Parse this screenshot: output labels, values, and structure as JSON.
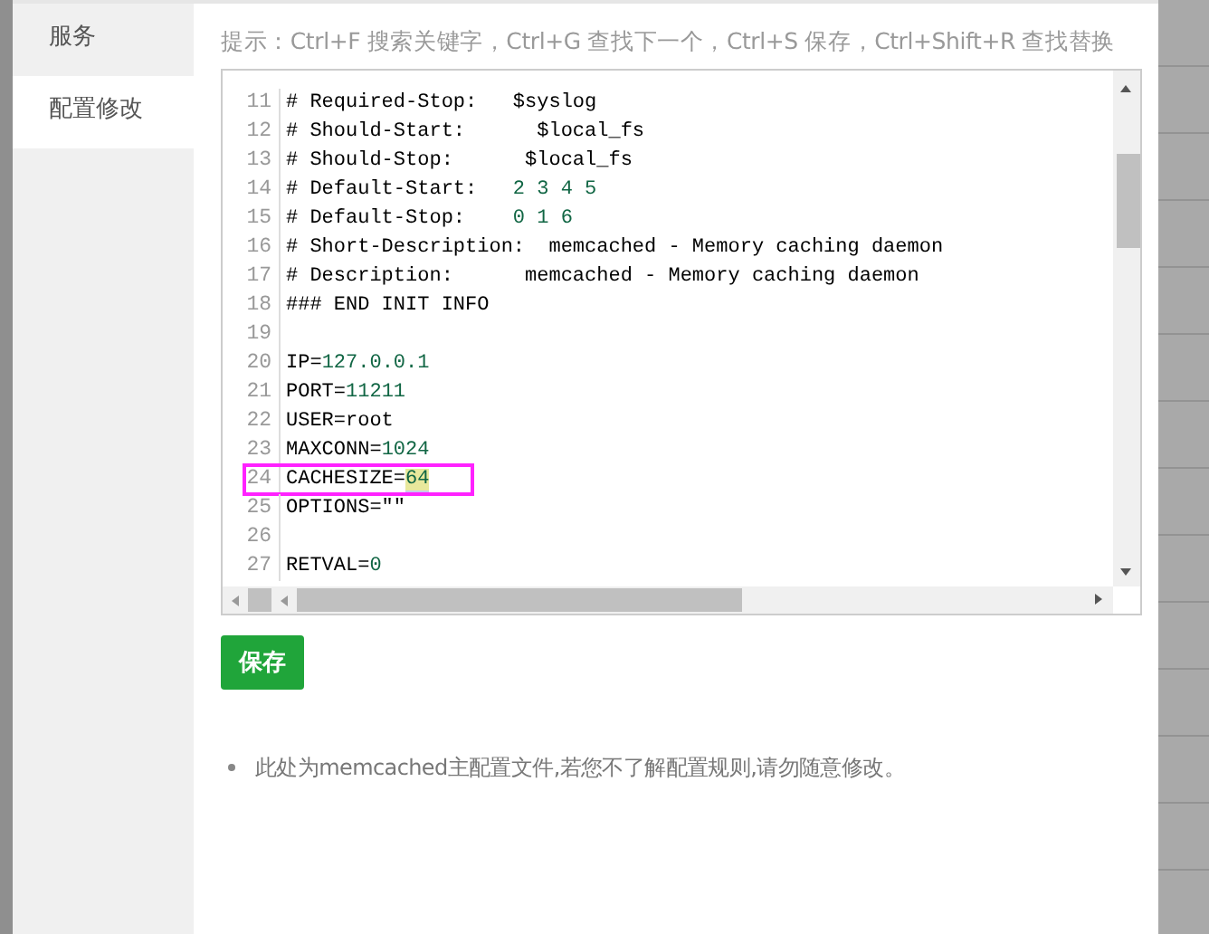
{
  "tabs": [
    {
      "label": "服务",
      "selected": false
    },
    {
      "label": "配置修改",
      "selected": true
    }
  ],
  "hint": "提示：Ctrl+F 搜索关键字，Ctrl+G 查找下一个，Ctrl+S 保存，Ctrl+Shift+R 查找替换",
  "editor": {
    "lines": [
      {
        "number": "11",
        "annotated": false,
        "tokens": [
          {
            "kind": "text",
            "text": "# Required-Stop:   $syslog"
          }
        ]
      },
      {
        "number": "12",
        "annotated": false,
        "tokens": [
          {
            "kind": "text",
            "text": "# Should-Start:      $local_fs"
          }
        ]
      },
      {
        "number": "13",
        "annotated": false,
        "tokens": [
          {
            "kind": "text",
            "text": "# Should-Stop:      $local_fs"
          }
        ]
      },
      {
        "number": "14",
        "annotated": false,
        "tokens": [
          {
            "kind": "text",
            "text": "# Default-Start:   "
          },
          {
            "kind": "number",
            "text": "2 3 4 5"
          }
        ]
      },
      {
        "number": "15",
        "annotated": false,
        "tokens": [
          {
            "kind": "text",
            "text": "# Default-Stop:    "
          },
          {
            "kind": "number",
            "text": "0 1 6"
          }
        ]
      },
      {
        "number": "16",
        "annotated": false,
        "tokens": [
          {
            "kind": "text",
            "text": "# Short-Description:  memcached - Memory caching daemon"
          }
        ]
      },
      {
        "number": "17",
        "annotated": false,
        "tokens": [
          {
            "kind": "text",
            "text": "# Description:      memcached - Memory caching daemon"
          }
        ]
      },
      {
        "number": "18",
        "annotated": false,
        "tokens": [
          {
            "kind": "text",
            "text": "### END INIT INFO"
          }
        ]
      },
      {
        "number": "19",
        "annotated": false
      },
      {
        "number": "20",
        "annotated": false,
        "tokens": [
          {
            "kind": "text",
            "text": "IP="
          },
          {
            "kind": "number",
            "text": "127.0.0.1"
          }
        ]
      },
      {
        "number": "21",
        "annotated": false,
        "tokens": [
          {
            "kind": "text",
            "text": "PORT="
          },
          {
            "kind": "number",
            "text": "11211"
          }
        ]
      },
      {
        "number": "22",
        "annotated": false,
        "tokens": [
          {
            "kind": "text",
            "text": "USER=root"
          }
        ]
      },
      {
        "number": "23",
        "annotated": false,
        "tokens": [
          {
            "kind": "text",
            "text": "MAXCONN="
          },
          {
            "kind": "number",
            "text": "1024"
          }
        ]
      },
      {
        "number": "24",
        "annotated": true,
        "tokens": [
          {
            "kind": "text",
            "text": "CACHESIZE="
          },
          {
            "kind": "match",
            "text": "64"
          }
        ]
      },
      {
        "number": "25",
        "annotated": false,
        "tokens": [
          {
            "kind": "text",
            "text": "OPTIONS=\"\""
          }
        ]
      },
      {
        "number": "26",
        "annotated": false
      },
      {
        "number": "27",
        "annotated": false,
        "tokens": [
          {
            "kind": "text",
            "text": "RETVAL="
          },
          {
            "kind": "number",
            "text": "0"
          }
        ]
      }
    ]
  },
  "save_button": "保存",
  "notes": [
    "此处为memcached主配置文件,若您不了解配置规则,请勿随意修改。"
  ]
}
